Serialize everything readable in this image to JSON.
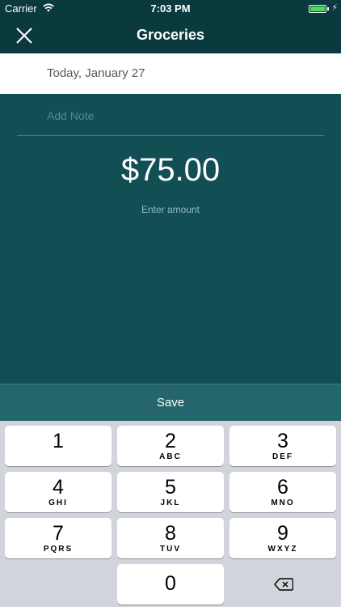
{
  "status_bar": {
    "carrier": "Carrier",
    "time": "7:03 PM",
    "battery_color": "#4cd964"
  },
  "nav": {
    "title": "Groceries",
    "close_icon": "close-icon"
  },
  "date_row": {
    "date": "Today, January 27"
  },
  "note": {
    "placeholder": "Add Note",
    "value": ""
  },
  "amount": {
    "value": "$75.00",
    "hint": "Enter amount"
  },
  "save": {
    "label": "Save"
  },
  "keypad": {
    "keys": [
      {
        "digit": "1",
        "letters": ""
      },
      {
        "digit": "2",
        "letters": "ABC"
      },
      {
        "digit": "3",
        "letters": "DEF"
      },
      {
        "digit": "4",
        "letters": "GHI"
      },
      {
        "digit": "5",
        "letters": "JKL"
      },
      {
        "digit": "6",
        "letters": "MNO"
      },
      {
        "digit": "7",
        "letters": "PQRS"
      },
      {
        "digit": "8",
        "letters": "TUV"
      },
      {
        "digit": "9",
        "letters": "WXYZ"
      },
      {
        "digit": "0",
        "letters": ""
      }
    ],
    "delete_icon": "backspace-icon"
  },
  "colors": {
    "header": "#0a3a3e",
    "main": "#114f55",
    "save_bar": "#24666b",
    "keyboard": "#d1d5db"
  }
}
